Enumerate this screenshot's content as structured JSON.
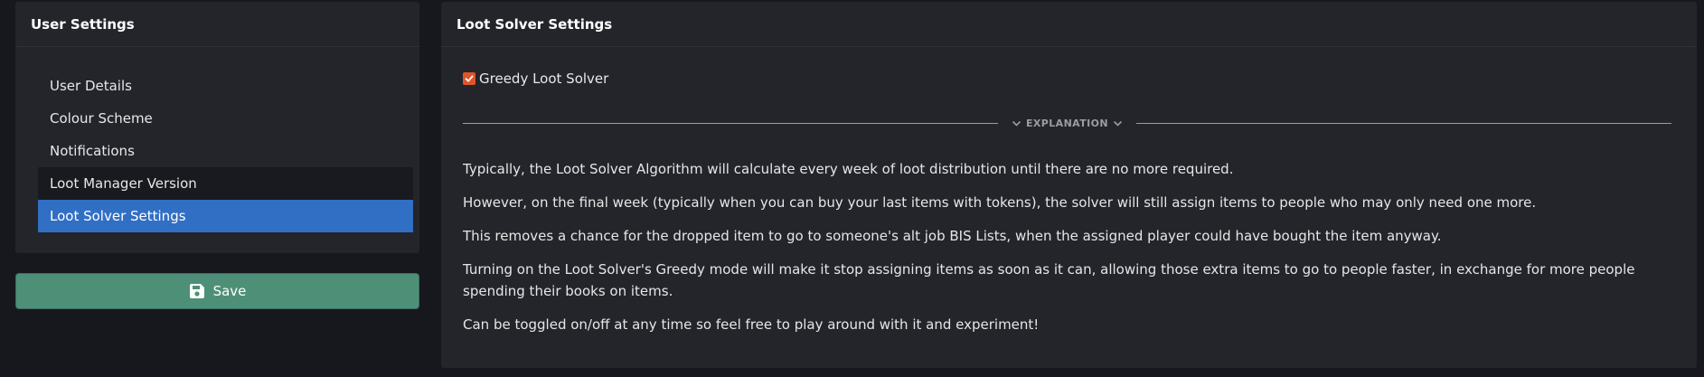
{
  "user_settings": {
    "title": "User Settings",
    "menu": [
      {
        "label": "User Details",
        "state": "normal"
      },
      {
        "label": "Colour Scheme",
        "state": "normal"
      },
      {
        "label": "Notifications",
        "state": "normal"
      },
      {
        "label": "Loot Manager Version",
        "state": "muted"
      },
      {
        "label": "Loot Solver Settings",
        "state": "active"
      }
    ]
  },
  "save": {
    "label": "Save",
    "icon": "floppy-disk-icon"
  },
  "loot_solver": {
    "title": "Loot Solver Settings",
    "checkbox_label": "Greedy Loot Solver",
    "checkbox_checked": true,
    "divider_label": "EXPLANATION",
    "paragraphs": [
      "Typically, the Loot Solver Algorithm will calculate every week of loot distribution until there are no more required.",
      "However, on the final week (typically when you can buy your last items with tokens), the solver will still assign items to people who may only need one more.",
      "This removes a chance for the dropped item to go to someone's alt job BIS Lists, when the assigned player could have bought the item anyway.",
      "Turning on the Loot Solver's Greedy mode will make it stop assigning items as soon as it can, allowing those extra items to go to people faster, in exchange for more people spending their books on items.",
      "Can be toggled on/off at any time so feel free to play around with it and experiment!"
    ]
  },
  "colors": {
    "active_item": "#316fc4",
    "save_button": "#4e8f78",
    "checkbox": "#e1542a",
    "background": "#17181d",
    "card": "#23252b"
  }
}
